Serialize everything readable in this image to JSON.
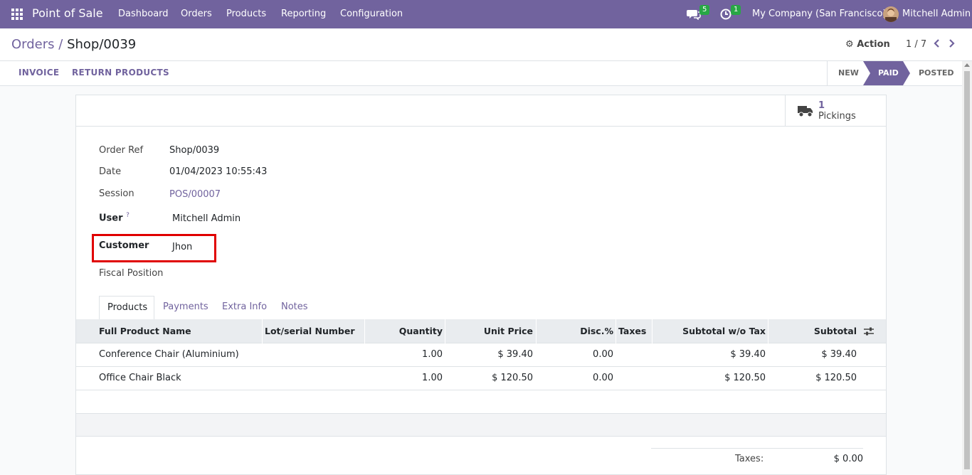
{
  "navbar": {
    "brand": "Point of Sale",
    "menu": [
      "Dashboard",
      "Orders",
      "Products",
      "Reporting",
      "Configuration"
    ],
    "messages_count": "5",
    "activities_count": "1",
    "company": "My Company (San Francisco)",
    "user": "Mitchell Admin"
  },
  "breadcrumb": {
    "parent": "Orders",
    "separator": "/",
    "current": "Shop/0039"
  },
  "control": {
    "action_label": "Action",
    "pager": "1 / 7"
  },
  "statusbar": {
    "buttons": [
      "INVOICE",
      "RETURN PRODUCTS"
    ],
    "stages": [
      "NEW",
      "PAID",
      "POSTED"
    ],
    "active_stage": "PAID"
  },
  "smart_button": {
    "count": "1",
    "label": "Pickings"
  },
  "fields": {
    "order_ref_label": "Order Ref",
    "order_ref": "Shop/0039",
    "date_label": "Date",
    "date": "01/04/2023 10:55:43",
    "session_label": "Session",
    "session": "POS/00007",
    "user_label": "User",
    "user_help": "?",
    "user": "Mitchell Admin",
    "customer_label": "Customer",
    "customer": "Jhon",
    "fiscal_label": "Fiscal Position",
    "fiscal": ""
  },
  "tabs": [
    "Products",
    "Payments",
    "Extra Info",
    "Notes"
  ],
  "table": {
    "columns": [
      "Full Product Name",
      "Lot/serial Number",
      "Quantity",
      "Unit Price",
      "Disc.%",
      "Taxes",
      "Subtotal w/o Tax",
      "Subtotal"
    ],
    "rows": [
      [
        "Conference Chair (Aluminium)",
        "",
        "1.00",
        "$ 39.40",
        "0.00",
        "",
        "$ 39.40",
        "$ 39.40"
      ],
      [
        "Office Chair Black",
        "",
        "1.00",
        "$ 120.50",
        "0.00",
        "",
        "$ 120.50",
        "$ 120.50"
      ]
    ]
  },
  "totals": {
    "taxes_label": "Taxes:",
    "taxes": "$ 0.00"
  }
}
